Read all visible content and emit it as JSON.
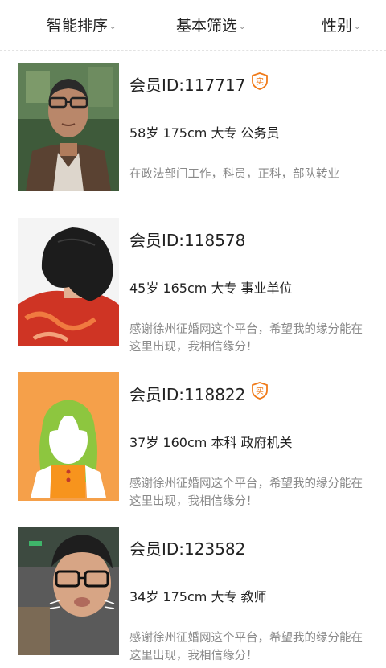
{
  "filters": [
    {
      "label": "智能排序"
    },
    {
      "label": "基本筛选"
    },
    {
      "label": "性别"
    }
  ],
  "members": [
    {
      "id_text": "会员ID:117717",
      "info": "58岁 175cm 大专 公务员",
      "desc": "在政法部门工作，科员，正科，部队转业",
      "badge": true,
      "badge_text": "实",
      "badge_color": "#f07b1a"
    },
    {
      "id_text": "会员ID:118578",
      "info": "45岁 165cm 大专 事业单位",
      "desc": "感谢徐州征婚网这个平台，希望我的缘分能在这里出现，我相信缘分！",
      "badge": false
    },
    {
      "id_text": "会员ID:118822",
      "info": "37岁 160cm 本科 政府机关",
      "desc": "感谢徐州征婚网这个平台，希望我的缘分能在这里出现，我相信缘分！",
      "badge": true,
      "badge_text": "实",
      "badge_color": "#f07b1a"
    },
    {
      "id_text": "会员ID:123582",
      "info": "34岁 175cm 大专 教师",
      "desc": "感谢徐州征婚网这个平台，希望我的缘分能在这里出现，我相信缘分！",
      "badge": false
    }
  ],
  "colors": {
    "accent": "#f07b1a",
    "avatar_bg": "#f5a04a",
    "avatar_hair": "#8dc63f"
  }
}
